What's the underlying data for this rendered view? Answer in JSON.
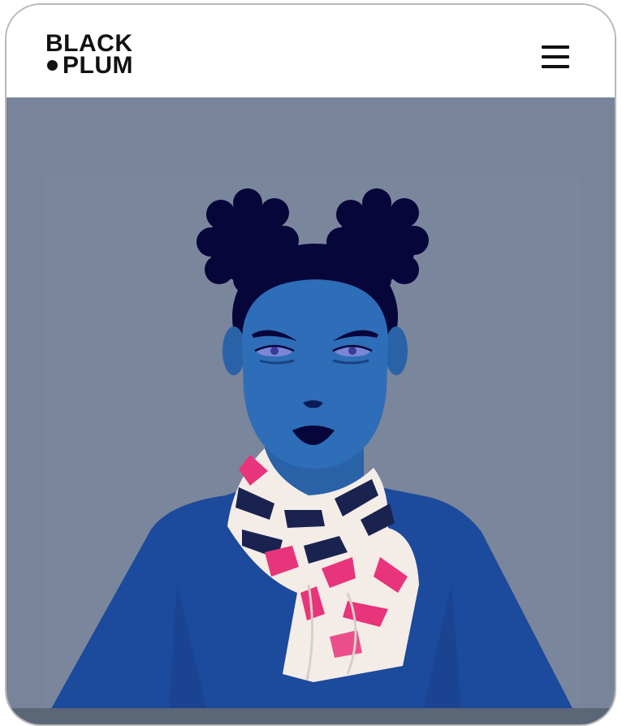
{
  "brand": {
    "line1": "BLACK",
    "line2": "PLUM"
  },
  "header": {
    "menu_icon": "hamburger-menu-icon"
  },
  "hero": {
    "image": "illustrated-woman-with-silk-scarf",
    "colors": {
      "background": "#78849a",
      "skin": "#2e6db8",
      "hair": "#06063a",
      "shirt": "#1c4a9c",
      "scarf_pink": "#e8347a",
      "scarf_navy": "#1a2350",
      "scarf_cream": "#f4ece6"
    }
  }
}
